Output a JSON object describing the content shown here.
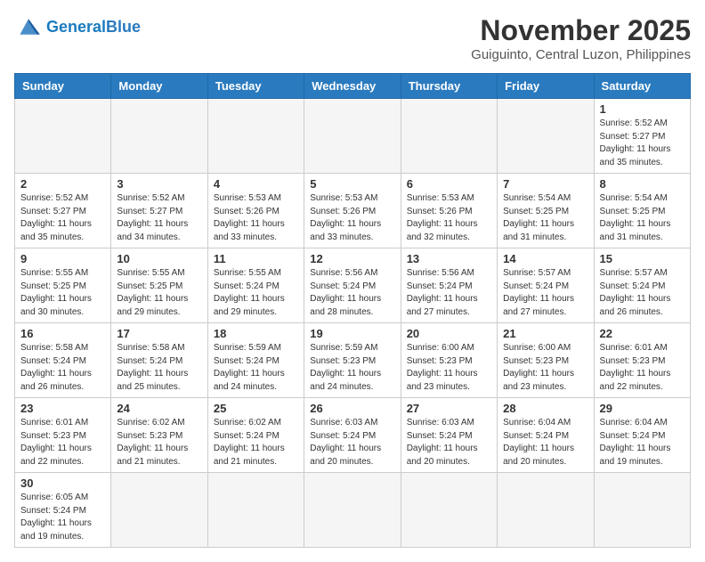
{
  "header": {
    "logo_general": "General",
    "logo_blue": "Blue",
    "month_title": "November 2025",
    "location": "Guiguinto, Central Luzon, Philippines"
  },
  "weekdays": [
    "Sunday",
    "Monday",
    "Tuesday",
    "Wednesday",
    "Thursday",
    "Friday",
    "Saturday"
  ],
  "weeks": [
    [
      {
        "day": "",
        "info": ""
      },
      {
        "day": "",
        "info": ""
      },
      {
        "day": "",
        "info": ""
      },
      {
        "day": "",
        "info": ""
      },
      {
        "day": "",
        "info": ""
      },
      {
        "day": "",
        "info": ""
      },
      {
        "day": "1",
        "info": "Sunrise: 5:52 AM\nSunset: 5:27 PM\nDaylight: 11 hours\nand 35 minutes."
      }
    ],
    [
      {
        "day": "2",
        "info": "Sunrise: 5:52 AM\nSunset: 5:27 PM\nDaylight: 11 hours\nand 35 minutes."
      },
      {
        "day": "3",
        "info": "Sunrise: 5:52 AM\nSunset: 5:27 PM\nDaylight: 11 hours\nand 34 minutes."
      },
      {
        "day": "4",
        "info": "Sunrise: 5:53 AM\nSunset: 5:26 PM\nDaylight: 11 hours\nand 33 minutes."
      },
      {
        "day": "5",
        "info": "Sunrise: 5:53 AM\nSunset: 5:26 PM\nDaylight: 11 hours\nand 33 minutes."
      },
      {
        "day": "6",
        "info": "Sunrise: 5:53 AM\nSunset: 5:26 PM\nDaylight: 11 hours\nand 32 minutes."
      },
      {
        "day": "7",
        "info": "Sunrise: 5:54 AM\nSunset: 5:25 PM\nDaylight: 11 hours\nand 31 minutes."
      },
      {
        "day": "8",
        "info": "Sunrise: 5:54 AM\nSunset: 5:25 PM\nDaylight: 11 hours\nand 31 minutes."
      }
    ],
    [
      {
        "day": "9",
        "info": "Sunrise: 5:55 AM\nSunset: 5:25 PM\nDaylight: 11 hours\nand 30 minutes."
      },
      {
        "day": "10",
        "info": "Sunrise: 5:55 AM\nSunset: 5:25 PM\nDaylight: 11 hours\nand 29 minutes."
      },
      {
        "day": "11",
        "info": "Sunrise: 5:55 AM\nSunset: 5:24 PM\nDaylight: 11 hours\nand 29 minutes."
      },
      {
        "day": "12",
        "info": "Sunrise: 5:56 AM\nSunset: 5:24 PM\nDaylight: 11 hours\nand 28 minutes."
      },
      {
        "day": "13",
        "info": "Sunrise: 5:56 AM\nSunset: 5:24 PM\nDaylight: 11 hours\nand 27 minutes."
      },
      {
        "day": "14",
        "info": "Sunrise: 5:57 AM\nSunset: 5:24 PM\nDaylight: 11 hours\nand 27 minutes."
      },
      {
        "day": "15",
        "info": "Sunrise: 5:57 AM\nSunset: 5:24 PM\nDaylight: 11 hours\nand 26 minutes."
      }
    ],
    [
      {
        "day": "16",
        "info": "Sunrise: 5:58 AM\nSunset: 5:24 PM\nDaylight: 11 hours\nand 26 minutes."
      },
      {
        "day": "17",
        "info": "Sunrise: 5:58 AM\nSunset: 5:24 PM\nDaylight: 11 hours\nand 25 minutes."
      },
      {
        "day": "18",
        "info": "Sunrise: 5:59 AM\nSunset: 5:24 PM\nDaylight: 11 hours\nand 24 minutes."
      },
      {
        "day": "19",
        "info": "Sunrise: 5:59 AM\nSunset: 5:23 PM\nDaylight: 11 hours\nand 24 minutes."
      },
      {
        "day": "20",
        "info": "Sunrise: 6:00 AM\nSunset: 5:23 PM\nDaylight: 11 hours\nand 23 minutes."
      },
      {
        "day": "21",
        "info": "Sunrise: 6:00 AM\nSunset: 5:23 PM\nDaylight: 11 hours\nand 23 minutes."
      },
      {
        "day": "22",
        "info": "Sunrise: 6:01 AM\nSunset: 5:23 PM\nDaylight: 11 hours\nand 22 minutes."
      }
    ],
    [
      {
        "day": "23",
        "info": "Sunrise: 6:01 AM\nSunset: 5:23 PM\nDaylight: 11 hours\nand 22 minutes."
      },
      {
        "day": "24",
        "info": "Sunrise: 6:02 AM\nSunset: 5:23 PM\nDaylight: 11 hours\nand 21 minutes."
      },
      {
        "day": "25",
        "info": "Sunrise: 6:02 AM\nSunset: 5:24 PM\nDaylight: 11 hours\nand 21 minutes."
      },
      {
        "day": "26",
        "info": "Sunrise: 6:03 AM\nSunset: 5:24 PM\nDaylight: 11 hours\nand 20 minutes."
      },
      {
        "day": "27",
        "info": "Sunrise: 6:03 AM\nSunset: 5:24 PM\nDaylight: 11 hours\nand 20 minutes."
      },
      {
        "day": "28",
        "info": "Sunrise: 6:04 AM\nSunset: 5:24 PM\nDaylight: 11 hours\nand 20 minutes."
      },
      {
        "day": "29",
        "info": "Sunrise: 6:04 AM\nSunset: 5:24 PM\nDaylight: 11 hours\nand 19 minutes."
      }
    ],
    [
      {
        "day": "30",
        "info": "Sunrise: 6:05 AM\nSunset: 5:24 PM\nDaylight: 11 hours\nand 19 minutes."
      },
      {
        "day": "",
        "info": ""
      },
      {
        "day": "",
        "info": ""
      },
      {
        "day": "",
        "info": ""
      },
      {
        "day": "",
        "info": ""
      },
      {
        "day": "",
        "info": ""
      },
      {
        "day": "",
        "info": ""
      }
    ]
  ]
}
